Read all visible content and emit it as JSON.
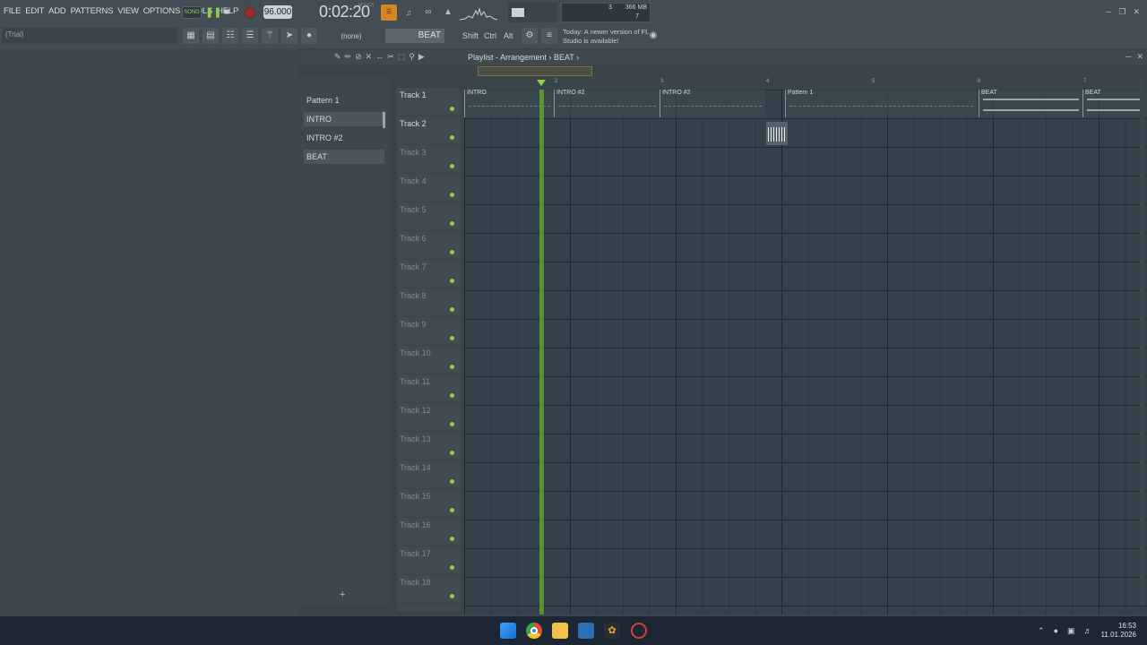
{
  "menu": [
    "FILE",
    "EDIT",
    "ADD",
    "PATTERNS",
    "VIEW",
    "OPTIONS",
    "TOOLS",
    "HELP"
  ],
  "transport": {
    "song_label": "SONG",
    "tempo": "96.000",
    "time": "0:02:20",
    "time_sub": "M:S:CS"
  },
  "meter": {
    "mem": "366 MB",
    "poly": "3",
    "poly2": "7"
  },
  "hint_text": "(Trial)",
  "pattern_none": "(none)",
  "pattern_selected": "BEAT",
  "keys": [
    "Shift",
    "Ctrl",
    "Alt"
  ],
  "news": "Today: A newer version of FL Studio is available!",
  "playlist": {
    "title": "Playlist - Arrangement › BEAT ›",
    "patterns": [
      "Pattern 1",
      "INTRO",
      "INTRO #2",
      "BEAT"
    ],
    "tracks": [
      "Track 1",
      "Track 2",
      "Track 3",
      "Track 4",
      "Track 5",
      "Track 6",
      "Track 7",
      "Track 8",
      "Track 9",
      "Track 10",
      "Track 11",
      "Track 12",
      "Track 13",
      "Track 14",
      "Track 15",
      "Track 16",
      "Track 17",
      "Track 18"
    ],
    "bars": [
      "2",
      "3",
      "4",
      "5",
      "6",
      "7"
    ],
    "clips": [
      {
        "label": "INTRO"
      },
      {
        "label": "INTRO #2"
      },
      {
        "label": "INTRO #2"
      },
      {
        "label": "Pattern 1"
      },
      {
        "label": "BEAT"
      },
      {
        "label": "BEAT"
      }
    ]
  },
  "taskbar": {
    "time": "16:53",
    "date": "11.01.2026"
  },
  "colors": {
    "accent_green": "#8fd14f",
    "orange": "#d4871e",
    "record_red": "#9b2a2a"
  }
}
